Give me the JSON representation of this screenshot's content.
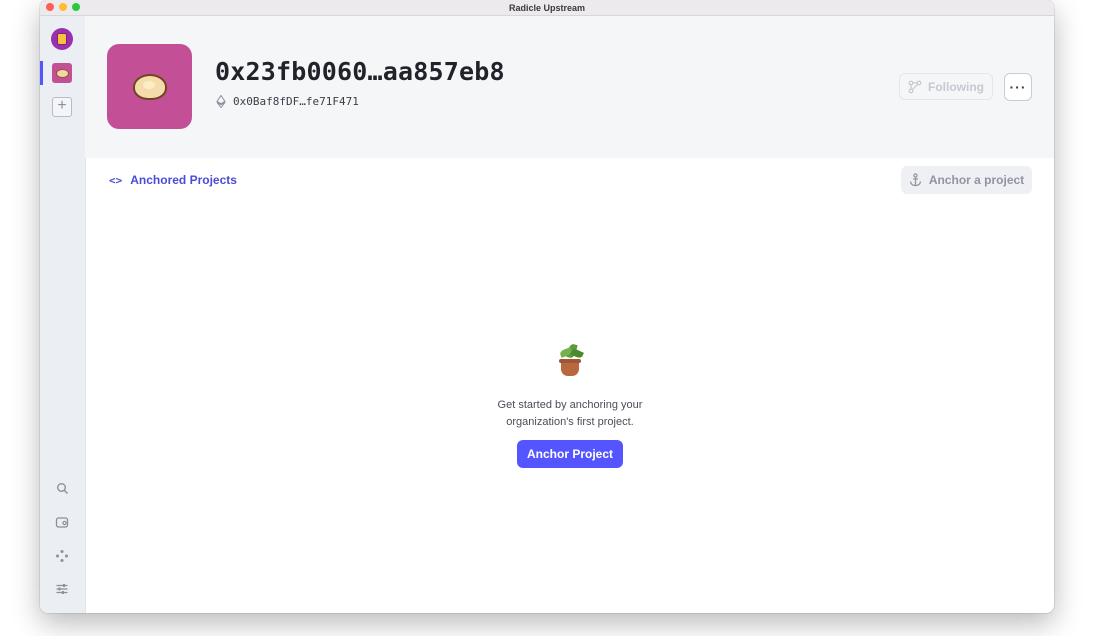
{
  "window": {
    "title": "Radicle Upstream"
  },
  "sidebar": {
    "top_items": [
      {
        "name": "identity-avatar"
      },
      {
        "name": "org-avatar"
      },
      {
        "name": "add-org",
        "icon": "plus-icon"
      }
    ],
    "bottom_items": [
      {
        "icon": "search-icon"
      },
      {
        "icon": "wallet-icon"
      },
      {
        "icon": "network-icon"
      },
      {
        "icon": "settings-icon"
      }
    ]
  },
  "org": {
    "name": "0x23fb0060…aa857eb8",
    "eth_address": "0x0Baf8fDF…fe71F471",
    "following_label": "Following",
    "more_label": "···"
  },
  "tabs": {
    "anchored_projects": "Anchored Projects"
  },
  "actions": {
    "anchor_a_project": "Anchor a project"
  },
  "empty_state": {
    "line1": "Get started by anchoring your",
    "line2": "organization's first project.",
    "button_label": "Anchor Project"
  },
  "colors": {
    "accent": "#5555ff",
    "org_avatar": "#c34f96",
    "identity_avatar": "#9b2fae"
  }
}
